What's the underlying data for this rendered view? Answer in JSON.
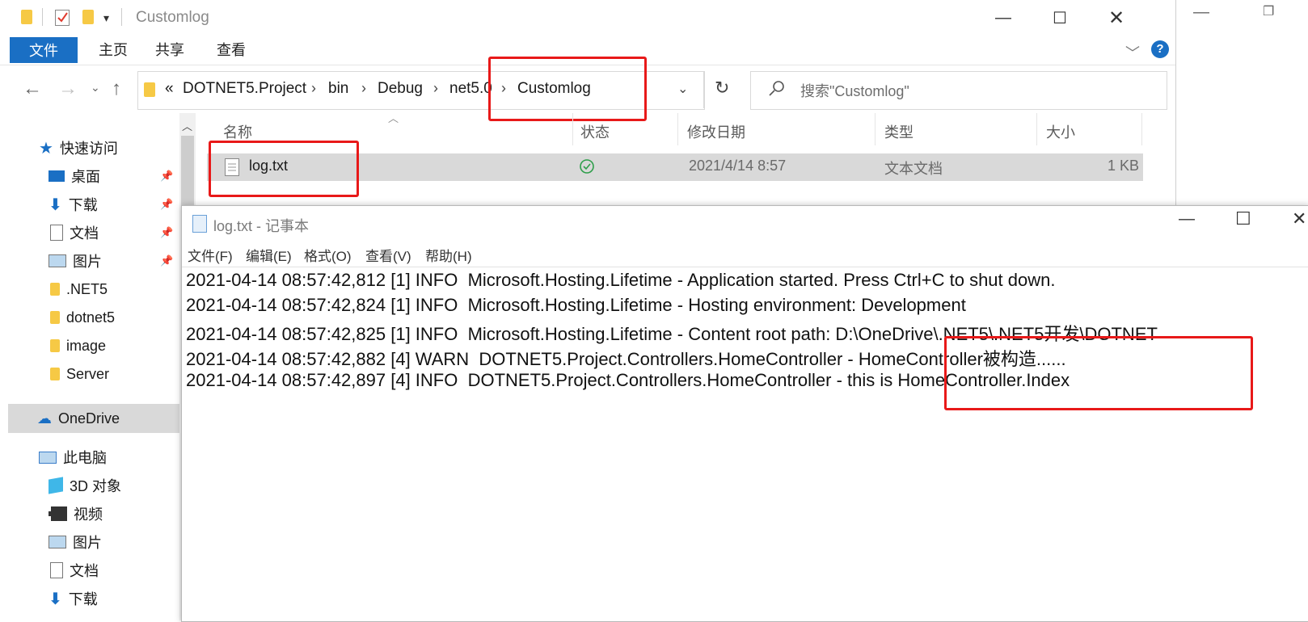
{
  "explorer": {
    "title": "Customlog",
    "ribbon_tabs": [
      "文件",
      "主页",
      "共享",
      "查看"
    ],
    "breadcrumbs": {
      "overflow": "«",
      "items": [
        "DOTNET5.Project",
        "bin",
        "Debug",
        "net5.0",
        "Customlog"
      ]
    },
    "search_placeholder": "搜索\"Customlog\"",
    "sidebar": {
      "quick_access": "快速访问",
      "quick_items": [
        "桌面",
        "下载",
        "文档",
        "图片",
        ".NET5",
        "dotnet5",
        "image",
        "Server"
      ],
      "onedrive": "OneDrive",
      "this_pc": "此电脑",
      "pc_items": [
        "3D 对象",
        "视频",
        "图片",
        "文档",
        "下载"
      ]
    },
    "columns": {
      "name": "名称",
      "status": "状态",
      "modified": "修改日期",
      "type": "类型",
      "size": "大小"
    },
    "file": {
      "name": "log.txt",
      "modified": "2021/4/14 8:57",
      "type": "文本文档",
      "size": "1 KB"
    }
  },
  "notepad": {
    "title": "log.txt - 记事本",
    "menus": [
      "文件(F)",
      "编辑(E)",
      "格式(O)",
      "查看(V)",
      "帮助(H)"
    ],
    "lines": [
      "2021-04-14 08:57:42,812 [1] INFO  Microsoft.Hosting.Lifetime - Application started. Press Ctrl+C to shut down.",
      "2021-04-14 08:57:42,824 [1] INFO  Microsoft.Hosting.Lifetime - Hosting environment: Development",
      "2021-04-14 08:57:42,825 [1] INFO  Microsoft.Hosting.Lifetime - Content root path: D:\\OneDrive\\.NET5\\.NET5开发\\DOTNET",
      "2021-04-14 08:57:42,882 [4] WARN  DOTNET5.Project.Controllers.HomeController - HomeController被构造......",
      "2021-04-14 08:57:42,897 [4] INFO  DOTNET5.Project.Controllers.HomeController - this is HomeController.Index"
    ]
  },
  "colors": {
    "accent": "#1a6fc4",
    "highlight": "#e81919",
    "selected_row": "#d9d9d9"
  }
}
